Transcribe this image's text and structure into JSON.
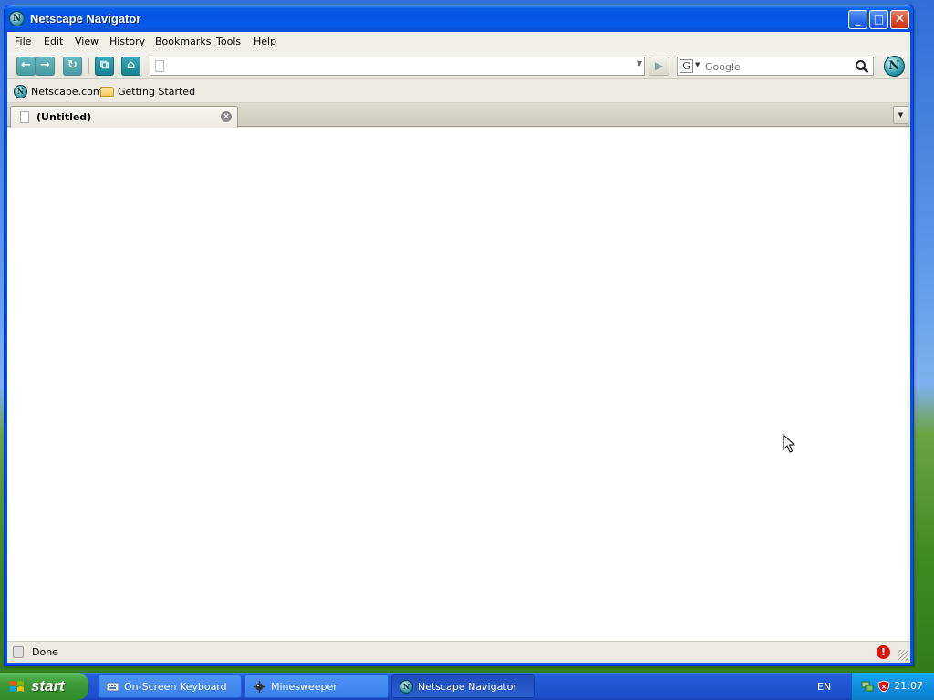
{
  "window": {
    "title": "Netscape Navigator",
    "buttons": {
      "minimize": "_",
      "maximize": "□",
      "close": "✕"
    }
  },
  "menu": [
    "File",
    "Edit",
    "View",
    "History",
    "Bookmarks",
    "Tools",
    "Help"
  ],
  "navbar": {
    "url_value": "",
    "search_placeholder": "Google",
    "search_engine_icon": "G"
  },
  "bookmarks": [
    {
      "label": "Netscape.com",
      "icon": "netscape-icon"
    },
    {
      "label": "Getting Started",
      "icon": "folder-icon"
    }
  ],
  "tabs": [
    {
      "title": "(Untitled)"
    }
  ],
  "status": {
    "text": "Done"
  },
  "taskbar": {
    "start_label": "start",
    "tasks": [
      {
        "label": "On-Screen Keyboard",
        "icon": "keyboard-icon"
      },
      {
        "label": "Minesweeper",
        "icon": "minesweeper-icon"
      },
      {
        "label": "Netscape Navigator",
        "icon": "netscape-icon",
        "active": true
      }
    ],
    "language": "EN",
    "clock": "21:07"
  },
  "colors": {
    "titlebar": "#0054e3",
    "netscape_teal": "#168290",
    "taskbar": "#245edb",
    "start_green": "#3c9a37",
    "tray": "#0f8fe0"
  }
}
